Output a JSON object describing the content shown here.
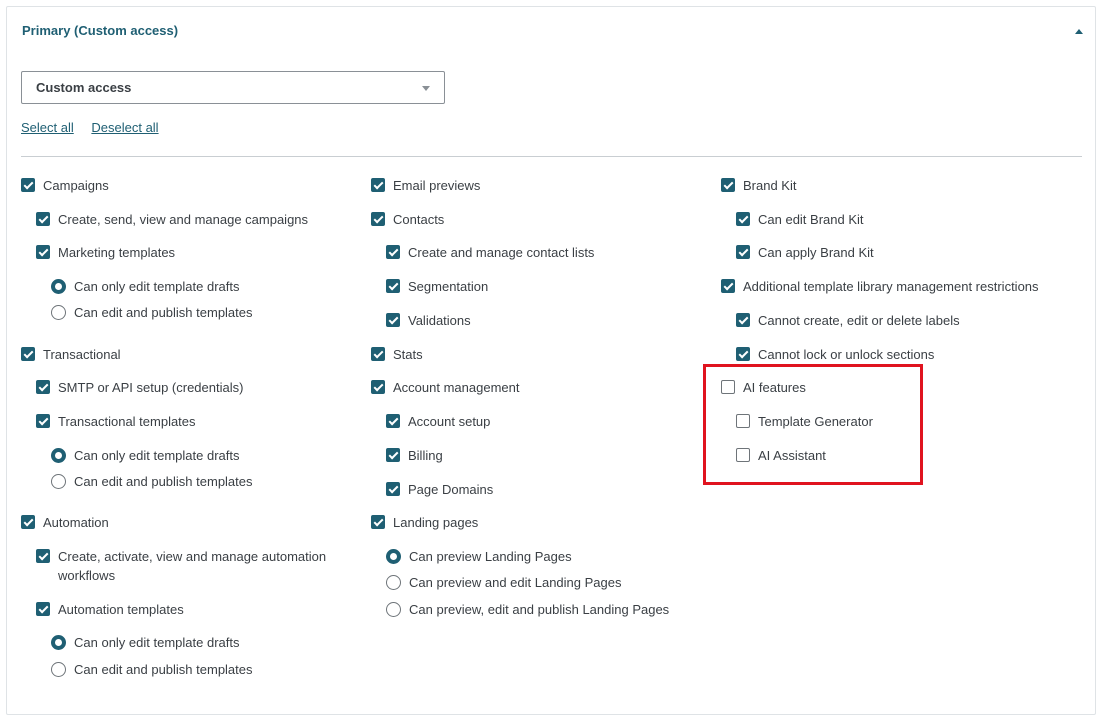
{
  "panel": {
    "title": "Primary (Custom access)",
    "access_select": {
      "value": "Custom access"
    },
    "select_all": "Select all",
    "deselect_all": "Deselect all"
  },
  "columns": [
    {
      "items": [
        {
          "label": "Campaigns",
          "type": "checkbox",
          "checked": true
        },
        {
          "label": "Create, send, view and manage campaigns",
          "type": "checkbox",
          "checked": true
        },
        {
          "label": "Marketing templates",
          "type": "checkbox",
          "checked": true
        },
        {
          "label": "Can only edit template drafts",
          "type": "radio",
          "checked": true
        },
        {
          "label": "Can edit and publish templates",
          "type": "radio",
          "checked": false
        },
        {
          "label": "Transactional",
          "type": "checkbox",
          "checked": true
        },
        {
          "label": "SMTP or API setup (credentials)",
          "type": "checkbox",
          "checked": true
        },
        {
          "label": "Transactional templates",
          "type": "checkbox",
          "checked": true
        },
        {
          "label": "Can only edit template drafts",
          "type": "radio",
          "checked": true
        },
        {
          "label": "Can edit and publish templates",
          "type": "radio",
          "checked": false
        },
        {
          "label": "Automation",
          "type": "checkbox",
          "checked": true
        },
        {
          "label": "Create, activate, view and manage automation workflows",
          "type": "checkbox",
          "checked": true
        },
        {
          "label": "Automation templates",
          "type": "checkbox",
          "checked": true
        },
        {
          "label": "Can only edit template drafts",
          "type": "radio",
          "checked": true
        },
        {
          "label": "Can edit and publish templates",
          "type": "radio",
          "checked": false
        }
      ]
    },
    {
      "items": [
        {
          "label": "Email previews",
          "type": "checkbox",
          "checked": true
        },
        {
          "label": "Contacts",
          "type": "checkbox",
          "checked": true
        },
        {
          "label": "Create and manage contact lists",
          "type": "checkbox",
          "checked": true
        },
        {
          "label": "Segmentation",
          "type": "checkbox",
          "checked": true
        },
        {
          "label": "Validations",
          "type": "checkbox",
          "checked": true
        },
        {
          "label": "Stats",
          "type": "checkbox",
          "checked": true
        },
        {
          "label": "Account management",
          "type": "checkbox",
          "checked": true
        },
        {
          "label": "Account setup",
          "type": "checkbox",
          "checked": true
        },
        {
          "label": "Billing",
          "type": "checkbox",
          "checked": true
        },
        {
          "label": "Page Domains",
          "type": "checkbox",
          "checked": true
        },
        {
          "label": "Landing pages",
          "type": "checkbox",
          "checked": true
        },
        {
          "label": "Can preview Landing Pages",
          "type": "radio",
          "checked": true
        },
        {
          "label": "Can preview and edit Landing Pages",
          "type": "radio",
          "checked": false
        },
        {
          "label": "Can preview, edit and publish Landing Pages",
          "type": "radio",
          "checked": false
        }
      ]
    },
    {
      "items": [
        {
          "label": "Brand Kit",
          "type": "checkbox",
          "checked": true
        },
        {
          "label": "Can edit Brand Kit",
          "type": "checkbox",
          "checked": true
        },
        {
          "label": "Can apply Brand Kit",
          "type": "checkbox",
          "checked": true
        },
        {
          "label": "Additional template library management restrictions",
          "type": "checkbox",
          "checked": true
        },
        {
          "label": "Cannot create, edit or delete labels",
          "type": "checkbox",
          "checked": true
        },
        {
          "label": "Cannot lock or unlock sections",
          "type": "checkbox",
          "checked": true
        },
        {
          "label": "AI features",
          "type": "checkbox",
          "checked": false
        },
        {
          "label": "Template Generator",
          "type": "checkbox",
          "checked": false
        },
        {
          "label": "AI Assistant",
          "type": "checkbox",
          "checked": false
        }
      ]
    }
  ],
  "colors": {
    "accent": "#1f5f73",
    "highlight": "#e0131f"
  }
}
